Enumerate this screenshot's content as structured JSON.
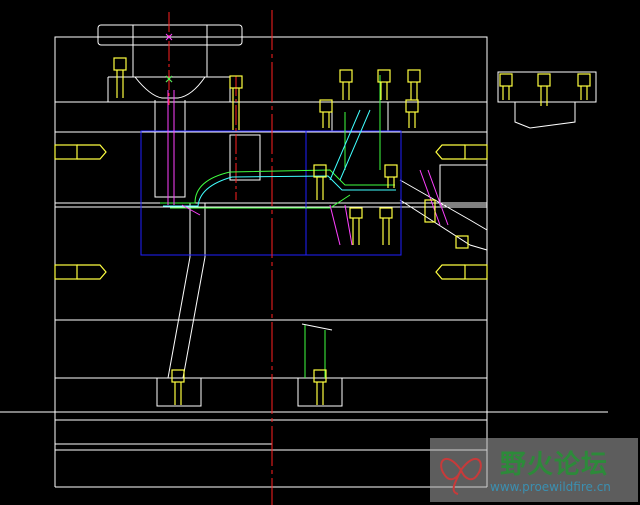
{
  "drawing": {
    "background": "#000000",
    "colors": {
      "outline": "#ffffff",
      "centerline": "#ff2020",
      "window": "#2020ff",
      "bolt": "#ffff40",
      "bolt_accent": "#ff60ff",
      "part": "#40ff40",
      "part_alt": "#40ffff",
      "slider": "#ff40ff"
    }
  },
  "watermark": {
    "title": "野火论坛",
    "url": "www.proewildfire.cn",
    "logo_icon": "butterfly-logo-icon",
    "title_color": "#2d8a3a",
    "url_color": "#3b8fb0"
  }
}
